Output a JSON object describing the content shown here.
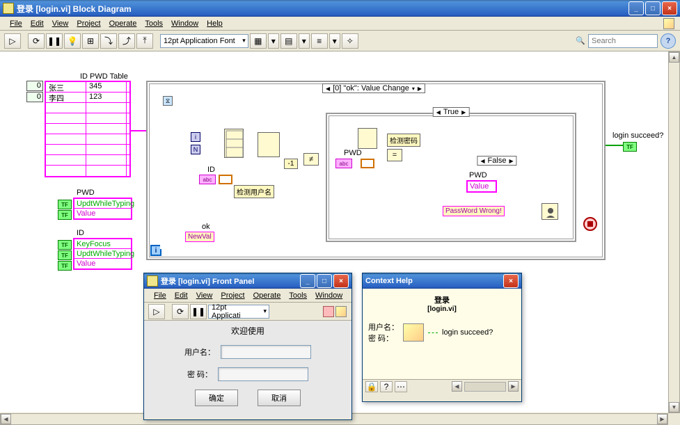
{
  "window": {
    "title": "登录 [login.vi] Block Diagram",
    "minimize": "_",
    "maximize": "□",
    "close": "×"
  },
  "menu": [
    "File",
    "Edit",
    "View",
    "Project",
    "Operate",
    "Tools",
    "Window",
    "Help"
  ],
  "toolbar": {
    "font": "12pt Application Font",
    "search_placeholder": "Search",
    "help": "?"
  },
  "table": {
    "label": "ID PWD Table",
    "rows": [
      {
        "idx": "0",
        "name": "张三",
        "pwd": "345"
      },
      {
        "idx": "0",
        "name": "李四",
        "pwd": "123"
      }
    ]
  },
  "prop_nodes": {
    "pwd": {
      "title": "PWD",
      "p1": "UpdtWhileTyping",
      "p2": "Value"
    },
    "id": {
      "title": "ID",
      "p1": "KeyFocus",
      "p2": "UpdtWhileTyping",
      "p3": "Value"
    },
    "pwd_inner": {
      "title": "PWD",
      "p1": "Value"
    }
  },
  "event_case": "[0] \"ok\": Value Change",
  "case_true": "True",
  "case_false": "False",
  "labels": {
    "ok": "ok",
    "newval": "NewVal",
    "id_label": "ID",
    "pwd_label": "PWD",
    "check_user": "检测用户名",
    "check_pwd": "检测密码",
    "minus1": "-1",
    "pw_wrong": "PassWord Wrong!",
    "login_succeed": "login succeed?",
    "abc": "abc"
  },
  "front_panel": {
    "title": "登录 [login.vi] Front Panel",
    "menu": [
      "File",
      "Edit",
      "View",
      "Project",
      "Operate",
      "Tools",
      "Window"
    ],
    "font": "12pt Applicati",
    "welcome": "欢迎使用",
    "user_label": "用户名：",
    "pwd_label": "密 码：",
    "ok_btn": "确定",
    "cancel_btn": "取消"
  },
  "context_help": {
    "title": "Context Help",
    "vi_name": "登录",
    "vi_file": "[login.vi]",
    "in1": "用户名：",
    "in2": "密 码：",
    "out": "login succeed?"
  },
  "chart_data": null
}
